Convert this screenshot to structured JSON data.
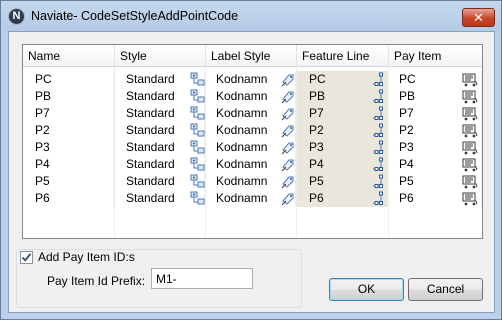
{
  "window": {
    "title": "Naviate- CodeSetStyleAddPointCode",
    "icon_letter": "N",
    "close_glyph": "✕"
  },
  "grid": {
    "columns": [
      "Name",
      "Style",
      "Label Style",
      "Feature Line",
      "Pay Item"
    ],
    "rows": [
      {
        "name": "PC",
        "style": "Standard",
        "label_style": "Kodnamn",
        "feature_line": "PC",
        "pay_item": "PC"
      },
      {
        "name": "PB",
        "style": "Standard",
        "label_style": "Kodnamn",
        "feature_line": "PB",
        "pay_item": "PB"
      },
      {
        "name": "P7",
        "style": "Standard",
        "label_style": "Kodnamn",
        "feature_line": "P7",
        "pay_item": "P7"
      },
      {
        "name": "P2",
        "style": "Standard",
        "label_style": "Kodnamn",
        "feature_line": "P2",
        "pay_item": "P2"
      },
      {
        "name": "P3",
        "style": "Standard",
        "label_style": "Kodnamn",
        "feature_line": "P3",
        "pay_item": "P3"
      },
      {
        "name": "P4",
        "style": "Standard",
        "label_style": "Kodnamn",
        "feature_line": "P4",
        "pay_item": "P4"
      },
      {
        "name": "P5",
        "style": "Standard",
        "label_style": "Kodnamn",
        "feature_line": "P5",
        "pay_item": "P5"
      },
      {
        "name": "P6",
        "style": "Standard",
        "label_style": "Kodnamn",
        "feature_line": "P6",
        "pay_item": "P6"
      }
    ],
    "icons": {
      "style": "point-style-icon",
      "label_style": "label-style-icon",
      "feature_line": "feature-line-icon",
      "pay_item": "pay-item-icon"
    }
  },
  "options": {
    "add_pay_item_label": "Add Pay Item ID:s",
    "add_pay_item_checked": true,
    "prefix_label": "Pay Item Id Prefix:",
    "prefix_value": "M1-"
  },
  "buttons": {
    "ok": "OK",
    "cancel": "Cancel"
  },
  "colors": {
    "title_bar": "#b9d1ea",
    "close_button": "#c9462c",
    "feature_line_cell": "#e9e7dc",
    "ok_border": "#3c7fb1"
  }
}
